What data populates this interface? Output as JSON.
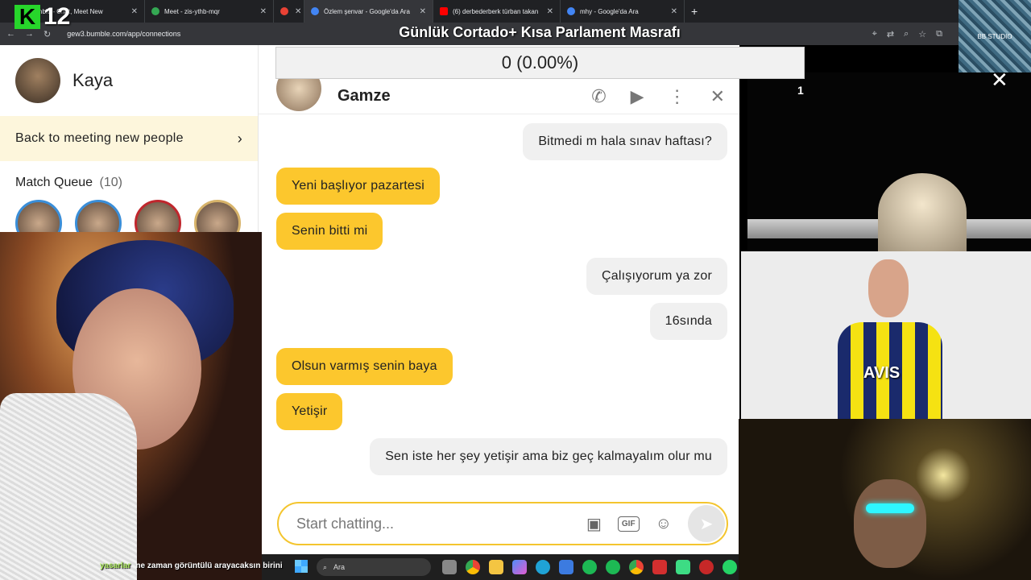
{
  "browser": {
    "tabs": [
      {
        "label": "Bumble - Chat, Meet New",
        "icon_color": "#f5c518",
        "active": false
      },
      {
        "label": "Meet - zis-ythb-mqr",
        "icon_color": "#34a853",
        "active": false
      },
      {
        "label": "",
        "icon_color": "#e94235",
        "active": false
      },
      {
        "label": "Özlem şenvar - Google'da Ara",
        "icon_color": "#4285f4",
        "active": true
      },
      {
        "label": "(6) derbederberk türban takan",
        "icon_color": "#ff0000",
        "active": false
      },
      {
        "label": "mhy - Google'da Ara",
        "icon_color": "#4285f4",
        "active": false
      }
    ],
    "url": "gew3.bumble.com/app/connections"
  },
  "overlay": {
    "logo_letter": "K",
    "logo_number": "12",
    "title": "Günlük Cortado+ Kısa Parlament Masrafı",
    "donation": "0 (0.00%)",
    "studio_label": "BB STUDIO",
    "cam_number": "1",
    "player_shirt": "AVIS"
  },
  "sidebar": {
    "profile_name": "Kaya",
    "back_label": "Back to meeting new people",
    "queue_label": "Match Queue",
    "queue_count": "(10)"
  },
  "chat": {
    "contact_name": "Gamze",
    "messages": [
      {
        "dir": "out",
        "text": "Bitmedi m hala sınav haftası?"
      },
      {
        "dir": "in",
        "text": "Yeni başlıyor pazartesi"
      },
      {
        "dir": "in",
        "text": "Senin bitti mi"
      },
      {
        "dir": "out",
        "text": "Çalışıyorum ya zor"
      },
      {
        "dir": "out",
        "text": "16sında"
      },
      {
        "dir": "in",
        "text": "Olsun varmış senin baya"
      },
      {
        "dir": "in",
        "text": "Yetişir"
      },
      {
        "dir": "out",
        "text": "Sen iste her şey yetişir ama biz geç kalmayalım olur mu"
      }
    ],
    "input_placeholder": "Start chatting...",
    "gif_label": "GIF"
  },
  "stream_chat": {
    "user": "yasarlar",
    "message": "ne zaman görüntülü arayacaksın birini"
  },
  "taskbar": {
    "search_placeholder": "Ara"
  }
}
